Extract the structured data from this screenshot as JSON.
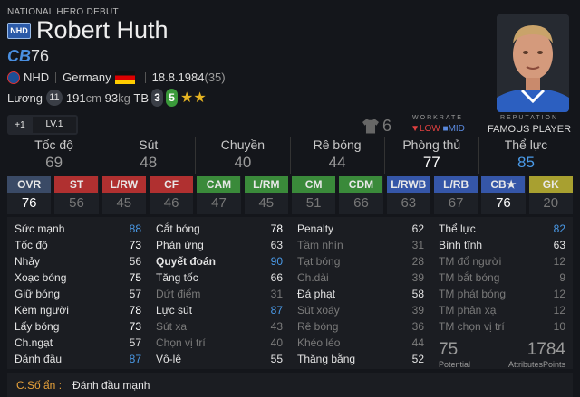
{
  "header": {
    "season": "NATIONAL HERO DEBUT",
    "badge": "NHD",
    "name": "Robert Huth",
    "pos": "CB",
    "ovr": "76"
  },
  "info": {
    "club": "NHD",
    "nation": "Germany",
    "dob": "18.8.1984",
    "age": "(35)"
  },
  "info2": {
    "salary_label": "Lương",
    "salary": "11",
    "height": "191",
    "height_unit": "cm",
    "weight": "93",
    "weight_unit": "kg",
    "build": "TB",
    "foot_left": "3",
    "foot_right": "5",
    "stars": "★★"
  },
  "level": {
    "plus": "+1",
    "lv": "LV.1"
  },
  "jersey": "6",
  "workrate": {
    "title": "WORKRATE",
    "att": "LOW",
    "def": "MID"
  },
  "reputation": {
    "title": "REPUTATION",
    "value": "FAMOUS PLAYER"
  },
  "categories": [
    {
      "label": "Tốc độ",
      "value": "69"
    },
    {
      "label": "Sút",
      "value": "48"
    },
    {
      "label": "Chuyền",
      "value": "40"
    },
    {
      "label": "Rê bóng",
      "value": "44"
    },
    {
      "label": "Phòng thủ",
      "value": "77"
    },
    {
      "label": "Thể lực",
      "value": "85"
    }
  ],
  "positions": [
    {
      "label": "OVR",
      "value": "76",
      "color": "#3a4a66"
    },
    {
      "label": "ST",
      "value": "56",
      "color": "#b03030"
    },
    {
      "label": "L/RW",
      "value": "45",
      "color": "#b03030"
    },
    {
      "label": "CF",
      "value": "46",
      "color": "#b03030"
    },
    {
      "label": "CAM",
      "value": "47",
      "color": "#3a8a3a"
    },
    {
      "label": "L/RM",
      "value": "45",
      "color": "#3a8a3a"
    },
    {
      "label": "CM",
      "value": "51",
      "color": "#3a8a3a"
    },
    {
      "label": "CDM",
      "value": "66",
      "color": "#3a8a3a"
    },
    {
      "label": "L/RWB",
      "value": "63",
      "color": "#3556a8"
    },
    {
      "label": "L/RB",
      "value": "67",
      "color": "#3556a8"
    },
    {
      "label": "CB★",
      "value": "76",
      "color": "#3556a8"
    },
    {
      "label": "GK",
      "value": "20",
      "color": "#a8a030"
    }
  ],
  "stats": {
    "col1": [
      {
        "n": "Sức mạnh",
        "v": "88"
      },
      {
        "n": "Tốc độ",
        "v": "73"
      },
      {
        "n": "Nhảy",
        "v": "56"
      },
      {
        "n": "Xoạc bóng",
        "v": "75"
      },
      {
        "n": "Giữ bóng",
        "v": "57"
      },
      {
        "n": "Kèm người",
        "v": "78"
      },
      {
        "n": "Lấy bóng",
        "v": "73"
      },
      {
        "n": "Ch.ngạt",
        "v": "57"
      },
      {
        "n": "Đánh đầu",
        "v": "87"
      }
    ],
    "col2": [
      {
        "n": "Cắt bóng",
        "v": "78"
      },
      {
        "n": "Phản ứng",
        "v": "63"
      },
      {
        "n": "Quyết đoán",
        "v": "90"
      },
      {
        "n": "Tăng tốc",
        "v": "66"
      },
      {
        "n": "Dứt điểm",
        "v": "31"
      },
      {
        "n": "Lực sút",
        "v": "87"
      },
      {
        "n": "Sút xa",
        "v": "43"
      },
      {
        "n": "Chọn vị trí",
        "v": "40"
      },
      {
        "n": "Vô-lê",
        "v": "55"
      }
    ],
    "col3": [
      {
        "n": "Penalty",
        "v": "62"
      },
      {
        "n": "Tầm nhìn",
        "v": "31"
      },
      {
        "n": "Tạt bóng",
        "v": "28"
      },
      {
        "n": "Ch.dài",
        "v": "39"
      },
      {
        "n": "Đá phạt",
        "v": "58"
      },
      {
        "n": "Sút xoáy",
        "v": "39"
      },
      {
        "n": "Rê bóng",
        "v": "36"
      },
      {
        "n": "Khéo léo",
        "v": "44"
      },
      {
        "n": "Thăng bằng",
        "v": "52"
      }
    ],
    "col4": [
      {
        "n": "Thể lực",
        "v": "82"
      },
      {
        "n": "Bình tĩnh",
        "v": "63"
      },
      {
        "n": "TM đổ người",
        "v": "12"
      },
      {
        "n": "TM bắt bóng",
        "v": "9"
      },
      {
        "n": "TM phát bóng",
        "v": "12"
      },
      {
        "n": "TM phản xạ",
        "v": "12"
      },
      {
        "n": "TM chọn vị trí",
        "v": "10"
      }
    ],
    "potential": "75",
    "potential_label": "Potential",
    "ap": "1784",
    "ap_label": "AttributesPoints"
  },
  "hidden": {
    "label": "C.Số ẩn :",
    "value": "Đánh đầu mạnh"
  }
}
